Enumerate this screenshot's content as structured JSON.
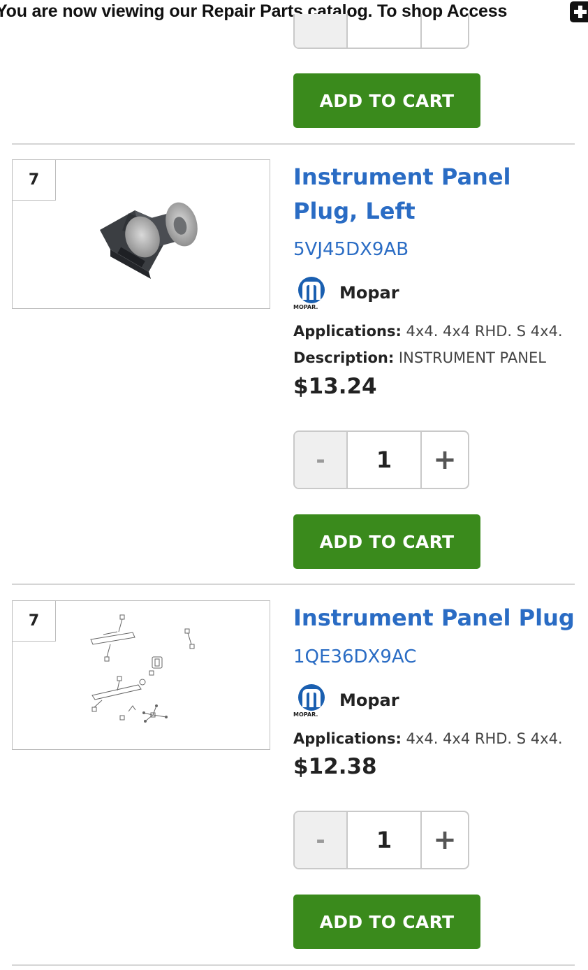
{
  "banner": {
    "text": "You are now viewing our Repair Parts catalog. To shop Access",
    "icon": "plus-square-icon"
  },
  "colors": {
    "link_blue": "#2a6cc4",
    "cart_green": "#3a8a1c",
    "border_gray": "#c9c9c9"
  },
  "cart_label": "ADD TO CART",
  "items": [
    {
      "ref_number": "7",
      "title": "Instrument Panel Plug, Left",
      "sku": "5VJ45DX9AB",
      "brand": "Mopar",
      "applications_label": "Applications:",
      "applications": "4x4. 4x4 RHD. S 4x4.",
      "description_label": "Description:",
      "description": "INSTRUMENT PANEL",
      "price": "$13.24",
      "quantity": "1",
      "image": "plug-photo"
    },
    {
      "ref_number": "7",
      "title": "Instrument Panel Plug",
      "sku": "1QE36DX9AC",
      "brand": "Mopar",
      "applications_label": "Applications:",
      "applications": "4x4. 4x4 RHD. S 4x4.",
      "price": "$12.38",
      "quantity": "1",
      "image": "parts-diagram"
    }
  ],
  "stepper": {
    "minus": "-",
    "plus": "+"
  },
  "mopar_logo_text": "MOPAR."
}
